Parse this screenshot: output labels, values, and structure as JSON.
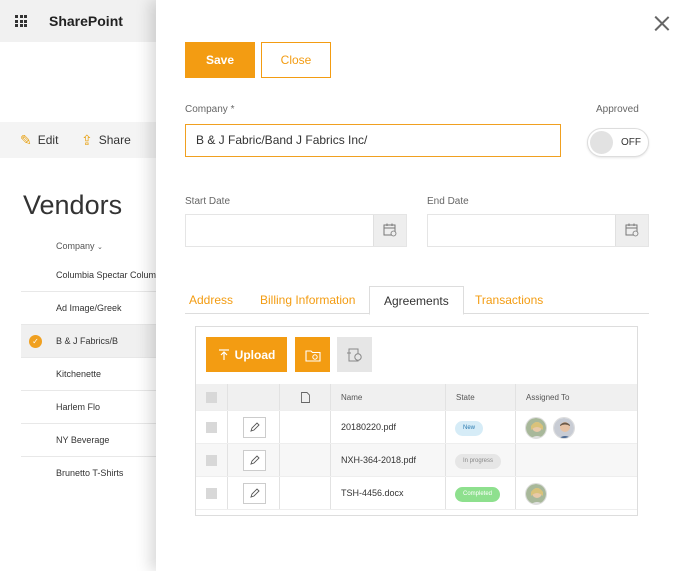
{
  "background": {
    "app_title": "SharePoint",
    "commands": {
      "edit": "Edit",
      "share": "Share"
    },
    "page_title": "Vendors",
    "column_header": "Company",
    "vendors": [
      "Columbia Spectar Colum",
      "Ad Image/Greek",
      "B & J Fabrics/B",
      "Kitchenette",
      "Harlem Flo",
      "NY Beverage",
      "Brunetto T-Shirts"
    ],
    "selected_vendor_index": 2
  },
  "panel": {
    "save_label": "Save",
    "close_label": "Close",
    "company_label": "Company *",
    "company_value": "B & J Fabric/Band J Fabrics Inc/",
    "approved_label": "Approved",
    "approved_toggle": "OFF",
    "start_date_label": "Start Date",
    "start_date_value": "",
    "end_date_label": "End Date",
    "end_date_value": "",
    "tabs": [
      "Address",
      "Billing Information",
      "Agreements",
      "Transactions"
    ],
    "active_tab": "Agreements"
  },
  "agreements": {
    "upload_label": "Upload",
    "columns": {
      "name": "Name",
      "state": "State",
      "assigned": "Assigned To"
    },
    "rows": [
      {
        "name": "20180220.pdf",
        "state": "New",
        "state_color": "#d6ecf7",
        "state_text_color": "#2a7ab0",
        "assignees": 2
      },
      {
        "name": "NXH-364-2018.pdf",
        "state": "In progress",
        "state_color": "#e6e6e6",
        "state_text_color": "#888888",
        "assignees": 0
      },
      {
        "name": "TSH-4456.docx",
        "state": "Completed",
        "state_color": "#8ee08e",
        "state_text_color": "#ffffff",
        "assignees": 1
      }
    ]
  },
  "colors": {
    "accent": "#f39c12"
  }
}
